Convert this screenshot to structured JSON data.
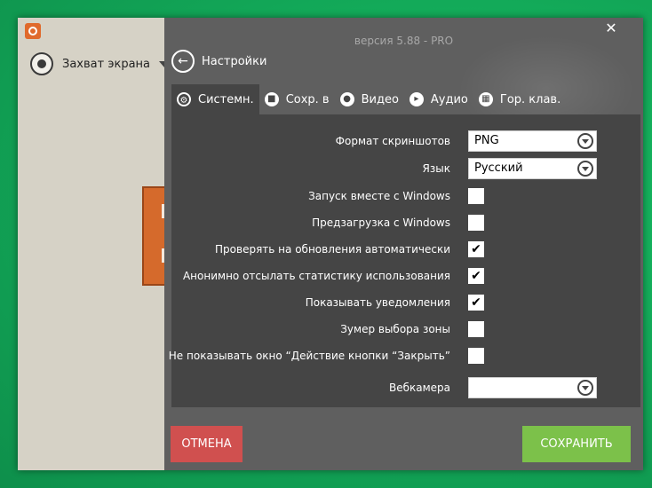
{
  "window": {
    "version": "версия 5.88 - PRO",
    "close_glyph": "✕"
  },
  "sidebar": {
    "capture_label": "Захват экрана"
  },
  "header": {
    "back_label": "Настройки"
  },
  "tabs": [
    {
      "label": "Системн.",
      "icon": "gear-icon",
      "active": true
    },
    {
      "label": "Сохр. в",
      "icon": "folder-icon",
      "active": false
    },
    {
      "label": "Видео",
      "icon": "record-icon",
      "active": false
    },
    {
      "label": "Аудио",
      "icon": "speaker-icon",
      "active": false
    },
    {
      "label": "Гор. клав.",
      "icon": "keyboard-icon",
      "active": false
    }
  ],
  "settings": {
    "screenshot_format": {
      "label": "Формат скриншотов",
      "value": "PNG"
    },
    "language": {
      "label": "Язык",
      "value": "Русский"
    },
    "checks": [
      {
        "label": "Запуск вместе с Windows",
        "checked": false
      },
      {
        "label": "Предзагрузка с Windows",
        "checked": false
      },
      {
        "label": "Проверять на обновления автоматически",
        "checked": true
      },
      {
        "label": "Анонимно отсылать статистику использования",
        "checked": true
      },
      {
        "label": "Показывать уведомления",
        "checked": true
      },
      {
        "label": "Зумер выбора зоны",
        "checked": false
      },
      {
        "label": "Не показывать окно “Действие кнопки “Закрыть”",
        "checked": false
      }
    ],
    "webcam": {
      "label": "Вебкамера",
      "value": ""
    }
  },
  "footer": {
    "cancel_label": "ОТМЕНА",
    "save_label": "СОХРАНИТЬ"
  },
  "colors": {
    "cancel": "#d0504f",
    "save": "#7cc14a",
    "panel": "#5f5f5f",
    "content": "#454545"
  }
}
